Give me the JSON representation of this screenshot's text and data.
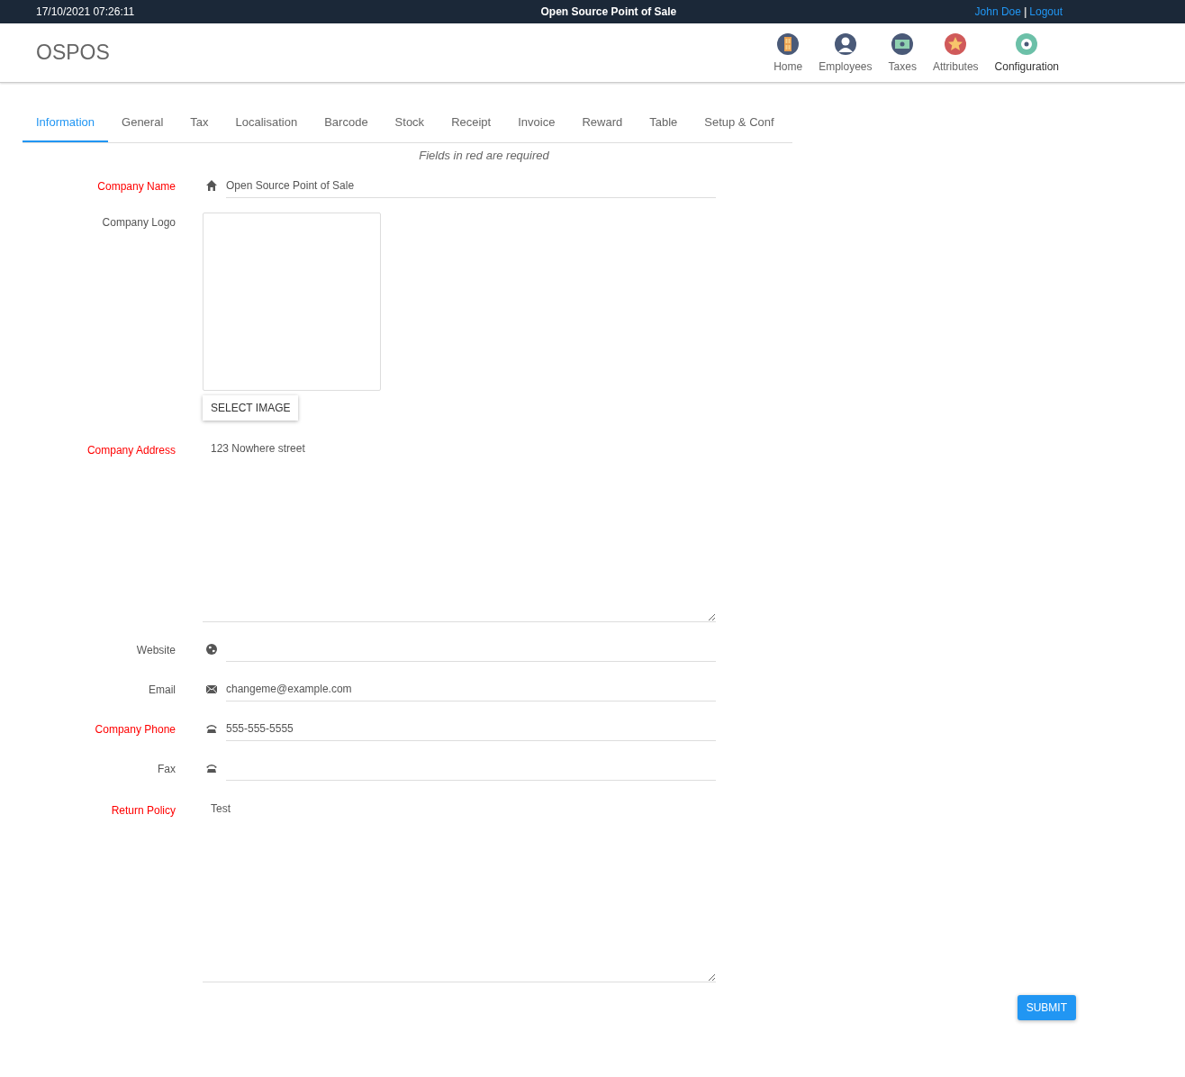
{
  "top_bar": {
    "datetime": "17/10/2021 07:26:11",
    "title": "Open Source Point of Sale",
    "user": "John Doe",
    "separator": "|",
    "logout": "Logout"
  },
  "header": {
    "logo": "OSPOS",
    "nav": [
      {
        "label": "Home",
        "kind": "home",
        "selected": false
      },
      {
        "label": "Employees",
        "kind": "employees",
        "selected": false
      },
      {
        "label": "Taxes",
        "kind": "taxes",
        "selected": false
      },
      {
        "label": "Attributes",
        "kind": "attributes",
        "selected": false
      },
      {
        "label": "Configuration",
        "kind": "configuration",
        "selected": true
      }
    ]
  },
  "tabs": [
    {
      "label": "Information",
      "selected": true
    },
    {
      "label": "General",
      "selected": false
    },
    {
      "label": "Tax",
      "selected": false
    },
    {
      "label": "Localisation",
      "selected": false
    },
    {
      "label": "Barcode",
      "selected": false
    },
    {
      "label": "Stock",
      "selected": false
    },
    {
      "label": "Receipt",
      "selected": false
    },
    {
      "label": "Invoice",
      "selected": false
    },
    {
      "label": "Reward",
      "selected": false
    },
    {
      "label": "Table",
      "selected": false
    },
    {
      "label": "Setup & Conf",
      "selected": false
    }
  ],
  "notice": "Fields in red are required",
  "fields": [
    {
      "kind": "name",
      "label": "Company Name",
      "required": true,
      "value": "Open Source Point of Sale"
    },
    {
      "kind": "image",
      "label": "Company Logo",
      "required": false,
      "button": "SELECT IMAGE"
    },
    {
      "kind": "textarea",
      "label": "Company Address",
      "required": true,
      "value": "123 Nowhere street"
    },
    {
      "kind": "website",
      "label": "Website",
      "required": false
    },
    {
      "kind": "email",
      "label": "Email",
      "required": false,
      "value": "changeme@example.com"
    },
    {
      "kind": "phone",
      "label": "Company Phone",
      "required": true,
      "value": "555-555-5555"
    },
    {
      "kind": "phone",
      "label": "Fax",
      "required": false
    },
    {
      "kind": "textarea",
      "label": "Return Policy",
      "required": true,
      "value": "Test"
    }
  ],
  "submit": "SUBMIT"
}
